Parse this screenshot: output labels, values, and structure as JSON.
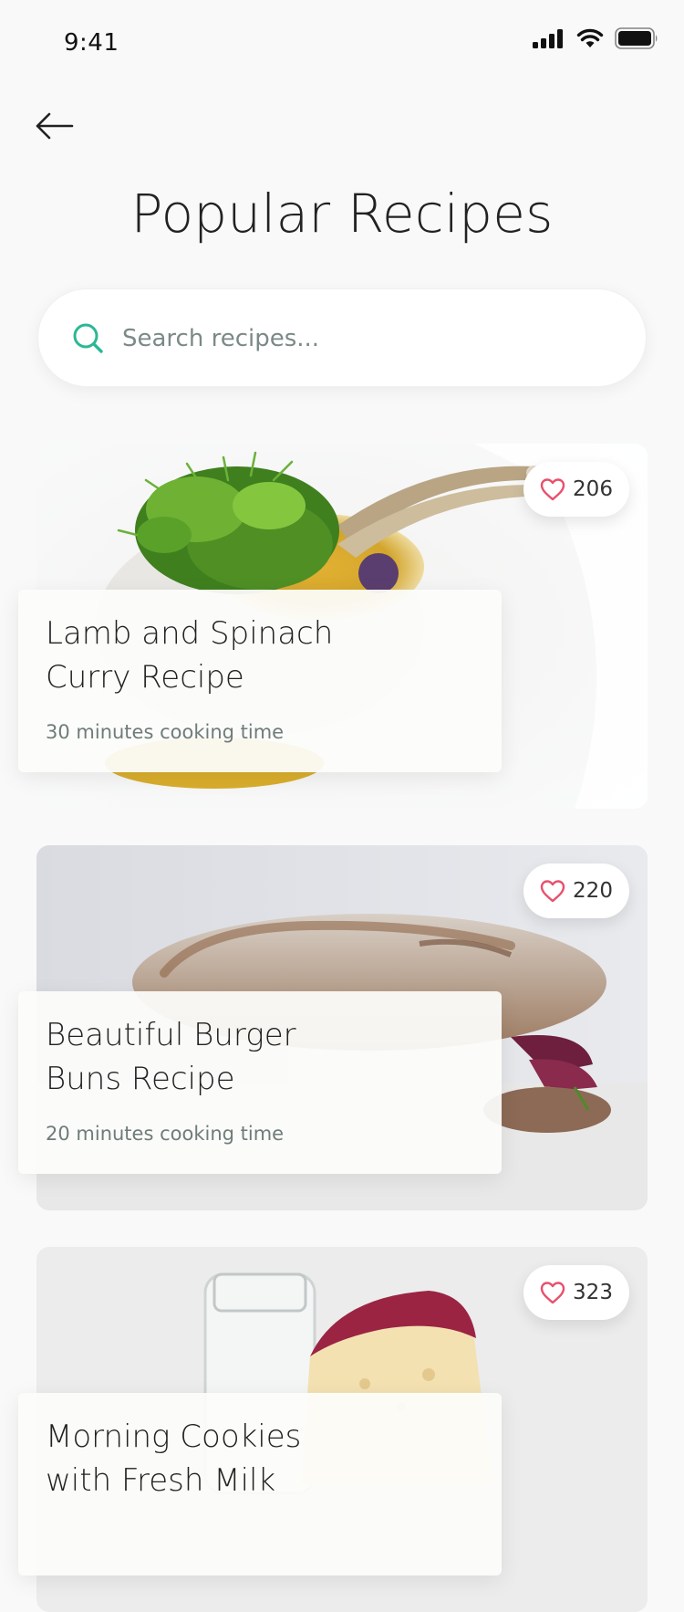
{
  "status_bar": {
    "time": "9:41",
    "icons": [
      "signal-icon",
      "wifi-icon",
      "battery-icon"
    ]
  },
  "header": {
    "back_icon": "arrow-left-icon",
    "title": "Popular Recipes"
  },
  "search": {
    "icon": "search-icon",
    "placeholder": "Search recipes...",
    "value": ""
  },
  "recipes": [
    {
      "title": "Lamb and Spinach Curry Recipe",
      "cooking_time": "30 minutes cooking time",
      "likes": "206"
    },
    {
      "title": "Beautiful Burger Buns Recipe",
      "cooking_time": "20 minutes cooking time",
      "likes": "220"
    },
    {
      "title": "Morning Cookies with Fresh Milk",
      "cooking_time": "",
      "likes": "323"
    }
  ],
  "colors": {
    "background": "#f9f9f9",
    "accent": "#2bb894",
    "heart": "#e8506d",
    "text_primary": "#222222",
    "text_secondary": "#6f7c7a"
  }
}
